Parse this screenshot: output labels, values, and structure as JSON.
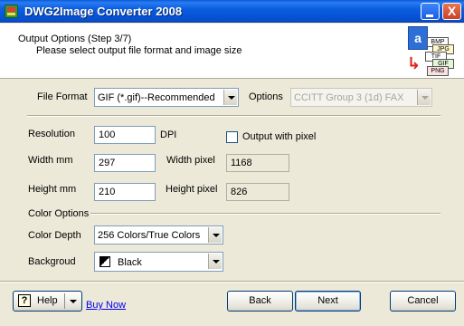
{
  "window": {
    "title": "DWG2Image Converter 2008",
    "close_glyph": "X"
  },
  "header": {
    "step_title": "Output Options (Step 3/7)",
    "step_subtitle": "Please select output file format and image size",
    "graphic_letter": "a",
    "graphic_formats": [
      "BMP",
      "JPG",
      "TIF",
      "GIF",
      "PNG"
    ]
  },
  "format": {
    "label": "File Format",
    "value": "GIF (*.gif)--Recommended",
    "options_label": "Options",
    "options_value": "CCITT Group 3 (1d) FAX"
  },
  "resolution": {
    "label": "Resolution",
    "value": "100",
    "unit": "DPI",
    "pixel_checkbox_label": "Output with pixel",
    "pixel_checked": false
  },
  "width": {
    "label": "Width mm",
    "value": "297",
    "pixel_label": "Width pixel",
    "pixel_value": "1168"
  },
  "height": {
    "label": "Height mm",
    "value": "210",
    "pixel_label": "Height pixel",
    "pixel_value": "826"
  },
  "color_options": {
    "section_label": "Color Options",
    "depth_label": "Color Depth",
    "depth_value": "256 Colors/True Colors",
    "background_label": "Backgroud",
    "background_value": "Black"
  },
  "footer": {
    "help_label": "Help",
    "help_glyph": "?",
    "buy_link": "Buy Now",
    "back_label": "Back",
    "next_label": "Next",
    "cancel_label": "Cancel"
  },
  "colors": {
    "titlebar": "#0553d6",
    "dialog_bg": "#ece9d8",
    "link": "#0000ee",
    "input_border": "#7f9db9"
  }
}
